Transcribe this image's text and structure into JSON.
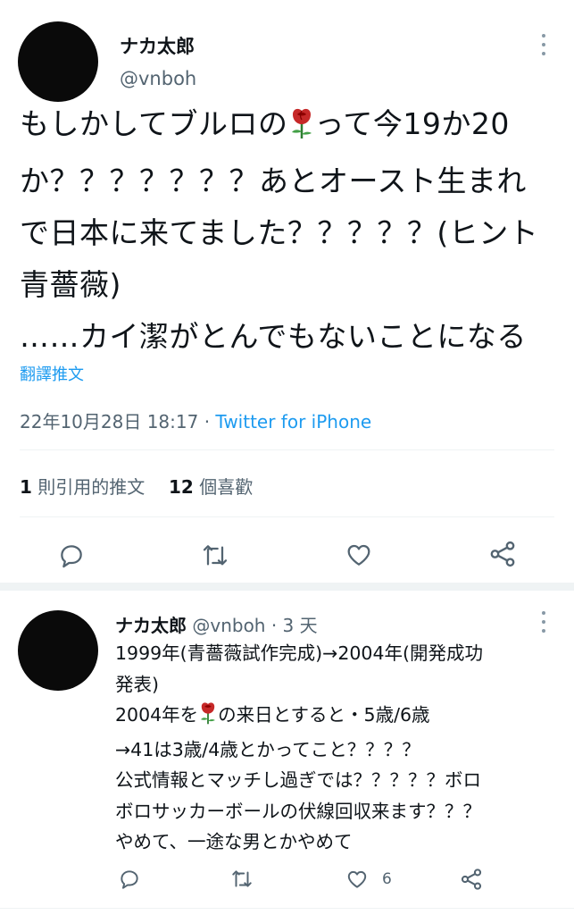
{
  "main_tweet": {
    "author_name": "ナカ太郎",
    "handle": "@vnboh",
    "text_lines": [
      "もしかしてブルロの",
      "って今19か20",
      "か？？？？？？？あとオースト生まれ",
      "で日本に来てました？？？？？(ヒント",
      "青薔薇)",
      "……カイ潔がとんでもないことになる"
    ],
    "translate_label": "翻譯推文",
    "date": "22年10月28日 18:17",
    "separator": " · ",
    "source": "Twitter for iPhone",
    "stats": {
      "quotes_count": "1",
      "quotes_label": "則引用的推文",
      "likes_count": "12",
      "likes_label": "個喜歡"
    }
  },
  "reply": {
    "author_name": "ナカ太郎",
    "handle_time": "@vnboh · 3 天",
    "lines": [
      "1999年(青薔薇試作完成)→2004年(開発成功",
      "発表)",
      "2004年を",
      "の来日とすると・5歳/6歳",
      "→41は3歳/4歳とかってこと？？？？",
      "公式情報とマッチし過ぎでは？？？？？ボロ",
      "ボロサッカーボールの伏線回収来ます？？？",
      "やめて、一途な男とかやめて"
    ],
    "like_count": "6"
  },
  "icons": {
    "reply": "reply-icon",
    "retweet": "retweet-icon",
    "like": "heart-icon",
    "share": "share-icon",
    "more": "more-icon",
    "rose": "rose-emoji-icon"
  },
  "colors": {
    "link": "#1d9bf0",
    "secondary_text": "#536471",
    "icon": "#536471",
    "avatar": "#0a0a0a"
  }
}
